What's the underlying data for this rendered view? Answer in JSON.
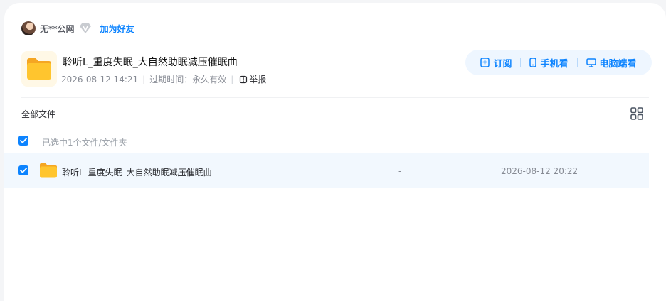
{
  "owner": {
    "name": "无**公网",
    "vip_icon": "diamond-v-icon",
    "add_friend": "加为好友"
  },
  "share": {
    "title": "聆听L_重度失眠_大自然助眠减压催眠曲",
    "created": "2026-08-12 14:21",
    "expiry_label": "过期时间：",
    "expiry_value": "永久有效",
    "report": "举报"
  },
  "actions": {
    "subscribe": "订阅",
    "mobile": "手机看",
    "desktop": "电脑端看"
  },
  "breadcrumb": "全部文件",
  "selection": {
    "text": "已选中1个文件/文件夹",
    "checked": true
  },
  "files": [
    {
      "name": "聆听L_重度失眠_大自然助眠减压催眠曲",
      "size": "-",
      "date": "2026-08-12 20:22",
      "checked": true
    }
  ],
  "colors": {
    "accent": "#0d84ff",
    "row_highlight": "#f2f8fe",
    "folder": "#ffc52e"
  }
}
